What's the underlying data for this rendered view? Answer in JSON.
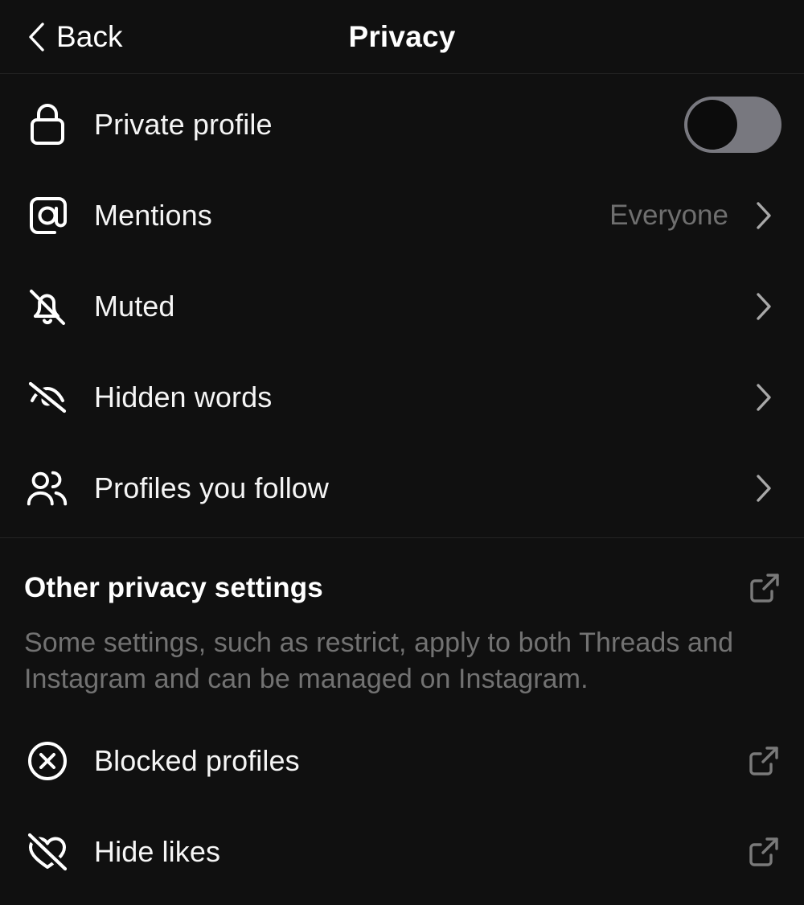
{
  "header": {
    "back_label": "Back",
    "back_icon": "chevron-left-icon",
    "title": "Privacy"
  },
  "privacy_settings": [
    {
      "label": "Private profile",
      "icon": "lock-icon",
      "accessory": "toggle",
      "toggle_on": false
    },
    {
      "label": "Mentions",
      "icon": "at-sign-icon",
      "accessory": "chevron",
      "value": "Everyone"
    },
    {
      "label": "Muted",
      "icon": "bell-slash-icon",
      "accessory": "chevron",
      "value": ""
    },
    {
      "label": "Hidden words",
      "icon": "eye-off-icon",
      "accessory": "chevron",
      "value": ""
    },
    {
      "label": "Profiles you follow",
      "icon": "people-icon",
      "accessory": "chevron",
      "value": ""
    }
  ],
  "other_section": {
    "title": "Other privacy settings",
    "title_icon": "external-link-icon",
    "description": "Some settings, such as restrict, apply to both Threads and Instagram and can be managed on Instagram.",
    "items": [
      {
        "label": "Blocked profiles",
        "icon": "circle-x-icon",
        "accessory": "external-link-icon"
      },
      {
        "label": "Hide likes",
        "icon": "heart-slash-icon",
        "accessory": "external-link-icon"
      }
    ]
  },
  "colors": {
    "background": "#101010",
    "divider": "#232323",
    "primary_text": "#f5f5f5",
    "secondary_text": "#727272",
    "toggle_off_track": "#78787f",
    "chevron": "#a0a0a0",
    "external_link": "#777777"
  }
}
